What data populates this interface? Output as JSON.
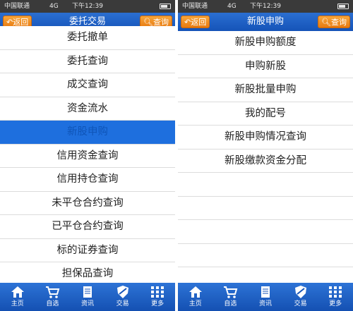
{
  "left": {
    "status": {
      "carrier": "中国联通",
      "network": "4G",
      "time": "下午12:39"
    },
    "nav": {
      "back": "返回",
      "title": "委托交易",
      "query": "查询"
    },
    "items": [
      {
        "label": "委托撤单"
      },
      {
        "label": "委托查询"
      },
      {
        "label": "成交查询"
      },
      {
        "label": "资金流水"
      },
      {
        "label": "新股申购"
      },
      {
        "label": "信用资金查询"
      },
      {
        "label": "信用持仓查询"
      },
      {
        "label": "未平仓合约查询"
      },
      {
        "label": "已平仓合约查询"
      },
      {
        "label": "标的证券查询"
      },
      {
        "label": "担保品查询"
      }
    ]
  },
  "right": {
    "status": {
      "carrier": "中国联通",
      "network": "4G",
      "time": "下午12:39"
    },
    "nav": {
      "back": "返回",
      "title": "新股申购",
      "query": "查询"
    },
    "items": [
      {
        "label": "新股申购额度"
      },
      {
        "label": "申购新股"
      },
      {
        "label": "新股批量申购"
      },
      {
        "label": "我的配号"
      },
      {
        "label": "新股申购情况查询"
      },
      {
        "label": "新股缴款资金分配"
      }
    ]
  },
  "tabs": [
    {
      "label": "主页",
      "icon": "home-icon"
    },
    {
      "label": "自选",
      "icon": "cart-icon"
    },
    {
      "label": "资讯",
      "icon": "scroll-icon"
    },
    {
      "label": "交易",
      "icon": "shield-icon"
    },
    {
      "label": "更多",
      "icon": "grid-icon"
    }
  ],
  "colors": {
    "nav": "#1553b8",
    "button": "#e87a10",
    "selected": "#1e6fde"
  }
}
